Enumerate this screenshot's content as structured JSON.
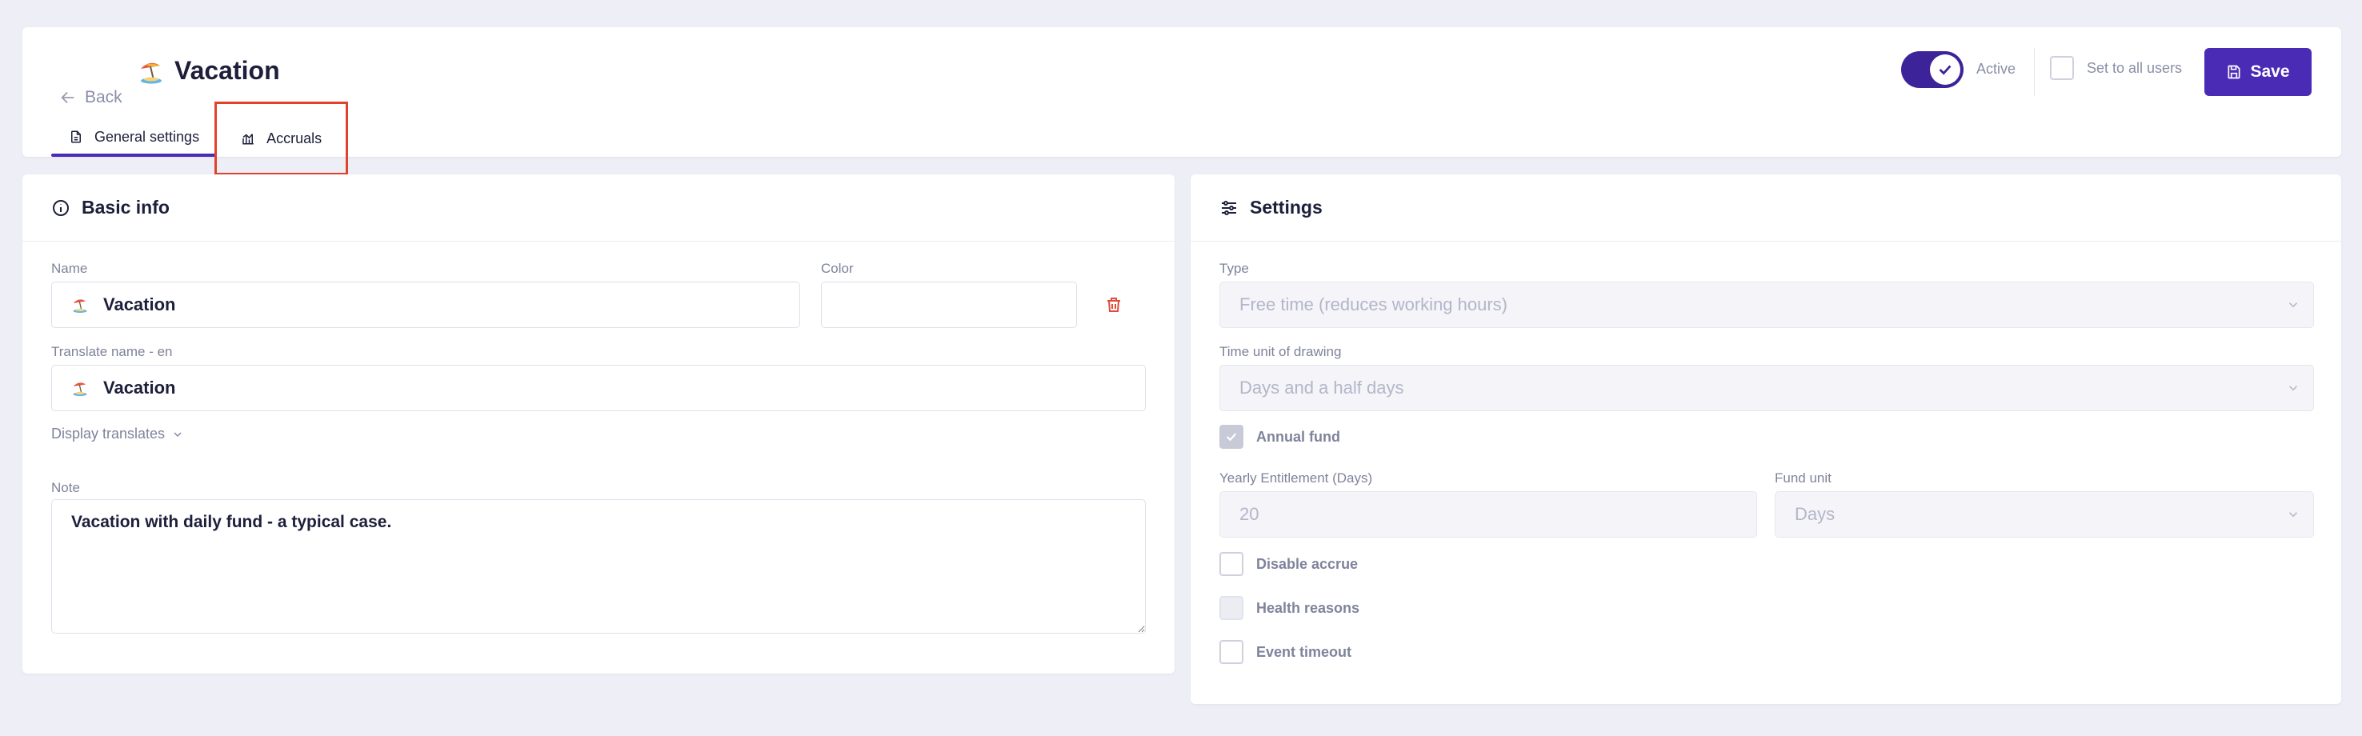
{
  "header": {
    "back_label": "Back",
    "title": "Vacation",
    "tabs": [
      {
        "label": "General settings",
        "active": true
      },
      {
        "label": "Accruals",
        "active": false
      }
    ],
    "toggle_label": "Active",
    "toggle_on": true,
    "set_all_label": "Set to all users",
    "save_label": "Save"
  },
  "basic_info": {
    "title": "Basic info",
    "name_label": "Name",
    "name_value": "Vacation",
    "color_label": "Color",
    "color_value": "",
    "translate_label": "Translate name - en",
    "translate_value": "Vacation",
    "display_translates": "Display translates",
    "note_label": "Note",
    "note_value": "Vacation with daily fund - a typical case."
  },
  "settings": {
    "title": "Settings",
    "type_label": "Type",
    "type_value": "Free time (reduces working hours)",
    "time_unit_label": "Time unit of drawing",
    "time_unit_value": "Days and a half days",
    "annual_fund_label": "Annual fund",
    "annual_fund_checked": true,
    "yearly_label": "Yearly Entitlement (Days)",
    "yearly_value": "20",
    "fund_unit_label": "Fund unit",
    "fund_unit_value": "Days",
    "disable_accrue_label": "Disable accrue",
    "health_reasons_label": "Health reasons",
    "event_timeout_label": "Event timeout"
  },
  "colors": {
    "primary": "#4a2bb5",
    "toggle": "#3d2399",
    "highlight": "#e0432b",
    "danger": "#e04a3a"
  }
}
